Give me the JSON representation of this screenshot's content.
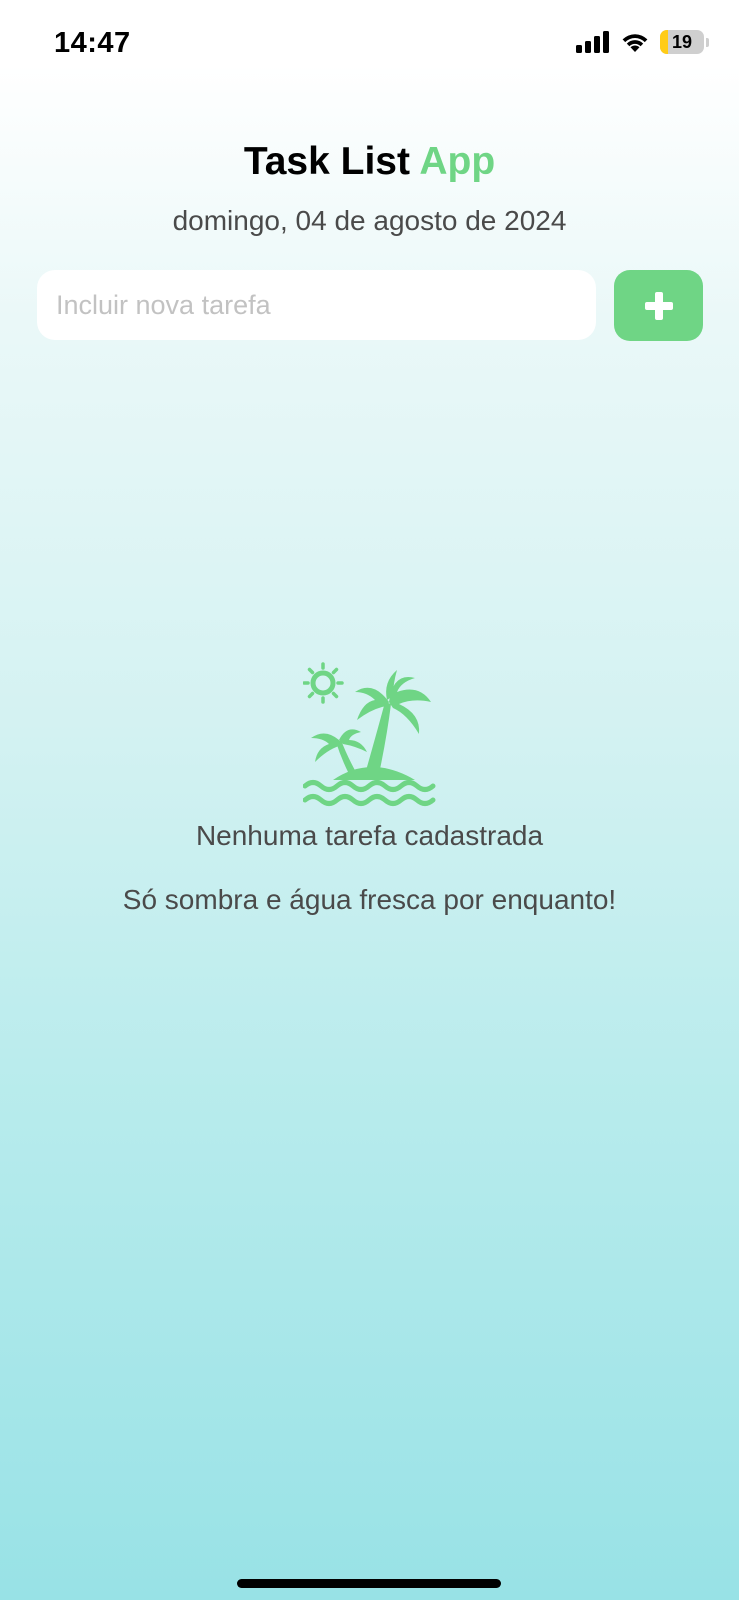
{
  "status_bar": {
    "time": "14:47",
    "battery_level": "19",
    "battery_fraction": 0.19,
    "icons": [
      "signal-icon",
      "wifi-icon",
      "battery-icon"
    ]
  },
  "header": {
    "title_main": "Task List",
    "title_accent": "App",
    "date": "domingo, 04 de agosto de 2024"
  },
  "new_task": {
    "placeholder": "Incluir nova tarefa",
    "value": "",
    "add_button_icon": "plus-icon"
  },
  "empty_state": {
    "icon": "island-palm-icon",
    "title": "Nenhuma tarefa cadastrada",
    "subtitle": "Só sombra e água fresca por enquanto!"
  },
  "colors": {
    "accent": "#6fd585",
    "text_muted": "#4a4a4a",
    "background_top": "#ffffff",
    "background_bottom": "#98e2e6"
  }
}
